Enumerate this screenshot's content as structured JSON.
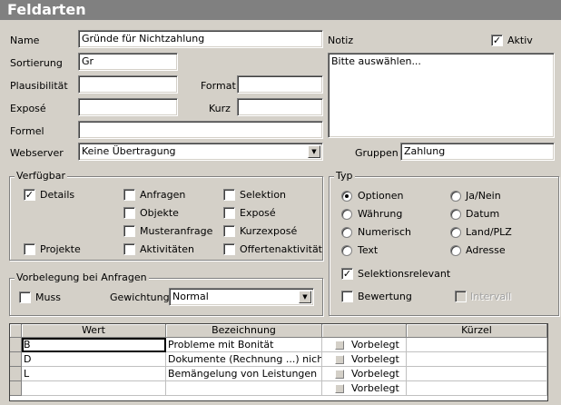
{
  "title": "Feldarten",
  "labels": {
    "name": "Name",
    "sortierung": "Sortierung",
    "plausibilitaet": "Plausibilität",
    "format": "Format",
    "expose": "Exposé",
    "kurz": "Kurz",
    "formel": "Formel",
    "webserver": "Webserver",
    "notiz": "Notiz",
    "aktiv": "Aktiv",
    "gruppen": "Gruppen"
  },
  "values": {
    "name": "Gründe für Nichtzahlung",
    "sortierung": "Gr",
    "plausibilitaet": "",
    "format": "",
    "expose": "",
    "kurz": "",
    "formel": "",
    "webserver": "Keine Übertragung",
    "notiz": "Bitte auswählen...",
    "gruppen": "Zahlung",
    "aktiv_checked": true
  },
  "verfuegbar": {
    "title": "Verfügbar",
    "items": {
      "details": {
        "label": "Details",
        "checked": true
      },
      "projekte": {
        "label": "Projekte",
        "checked": false
      },
      "anfragen": {
        "label": "Anfragen",
        "checked": false
      },
      "objekte": {
        "label": "Objekte",
        "checked": false
      },
      "musteranfrage": {
        "label": "Musteranfrage",
        "checked": false
      },
      "aktivitaeten": {
        "label": "Aktivitäten",
        "checked": false
      },
      "selektion": {
        "label": "Selektion",
        "checked": false
      },
      "expose": {
        "label": "Exposé",
        "checked": false
      },
      "kurzexpose": {
        "label": "Kurzexposé",
        "checked": false
      },
      "offertenaktivitaet": {
        "label": "Offertenaktivität",
        "checked": false
      }
    }
  },
  "vorbelegung": {
    "title": "Vorbelegung bei Anfragen",
    "muss_label": "Muss",
    "muss_checked": false,
    "gewichtung_label": "Gewichtung",
    "gewichtung_value": "Normal"
  },
  "typ": {
    "title": "Typ",
    "options": {
      "optionen": {
        "label": "Optionen",
        "selected": true
      },
      "waehrung": {
        "label": "Währung",
        "selected": false
      },
      "numerisch": {
        "label": "Numerisch",
        "selected": false
      },
      "text": {
        "label": "Text",
        "selected": false
      },
      "janein": {
        "label": "Ja/Nein",
        "selected": false
      },
      "datum": {
        "label": "Datum",
        "selected": false
      },
      "landplz": {
        "label": "Land/PLZ",
        "selected": false
      },
      "adresse": {
        "label": "Adresse",
        "selected": false
      }
    },
    "selektionsrelevant": {
      "label": "Selektionsrelevant",
      "checked": true
    },
    "bewertung": {
      "label": "Bewertung",
      "checked": false
    },
    "intervall": {
      "label": "Intervall",
      "checked": false,
      "disabled": true
    }
  },
  "table": {
    "headers": {
      "wert": "Wert",
      "bezeichnung": "Bezeichnung",
      "flag": "",
      "kuerzel": "Kürzel"
    },
    "rows": [
      {
        "wert": "B",
        "bezeichnung": "Probleme mit Bonität",
        "flag": "Vorbelegt",
        "kuerzel": ""
      },
      {
        "wert": "D",
        "bezeichnung": "Dokumente (Rechnung ...) nicht erh",
        "flag": "Vorbelegt",
        "kuerzel": ""
      },
      {
        "wert": "L",
        "bezeichnung": "Bemängelung von Leistungen",
        "flag": "Vorbelegt",
        "kuerzel": ""
      },
      {
        "wert": "",
        "bezeichnung": "",
        "flag": "Vorbelegt",
        "kuerzel": ""
      }
    ]
  }
}
